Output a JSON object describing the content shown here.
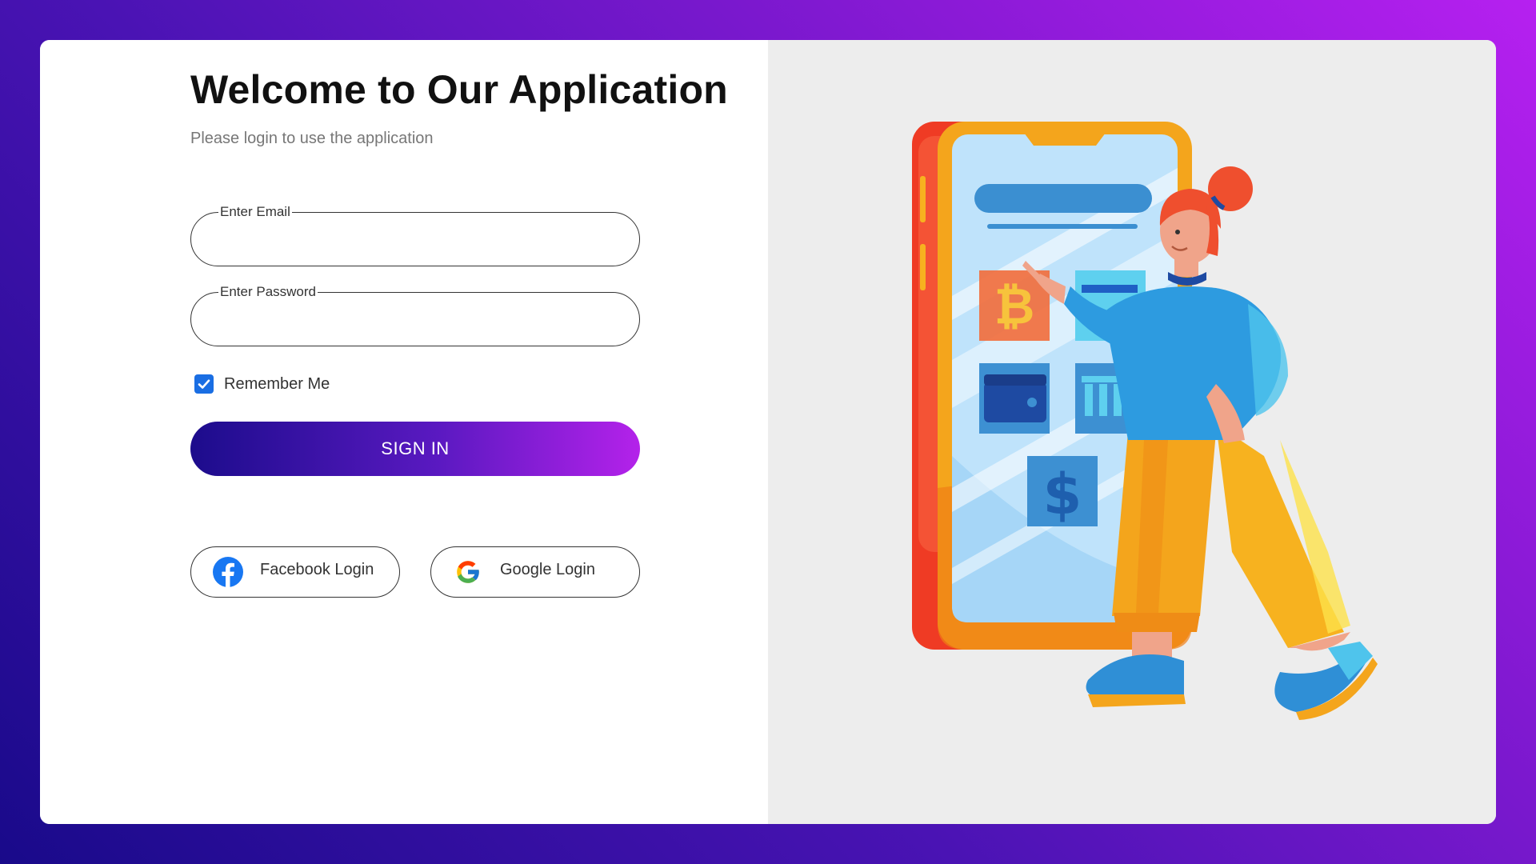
{
  "header": {
    "title": "Welcome to Our Application",
    "subtitle": "Please login to use the application"
  },
  "form": {
    "email_label": "Enter Email",
    "email_value": "",
    "password_label": "Enter Password",
    "password_value": "",
    "remember_label": "Remember Me",
    "remember_checked": true,
    "signin_label": "SIGN IN"
  },
  "social": {
    "facebook_label": "Facebook Login",
    "google_label": "Google Login"
  },
  "illustration": {
    "icons": [
      "bitcoin-icon",
      "credit-card-icon",
      "wallet-icon",
      "bank-icon",
      "dollar-icon"
    ]
  },
  "colors": {
    "background_start": "#190a8a",
    "background_end": "#b620f0",
    "checkbox": "#1a6ee3",
    "facebook": "#1877f2"
  }
}
